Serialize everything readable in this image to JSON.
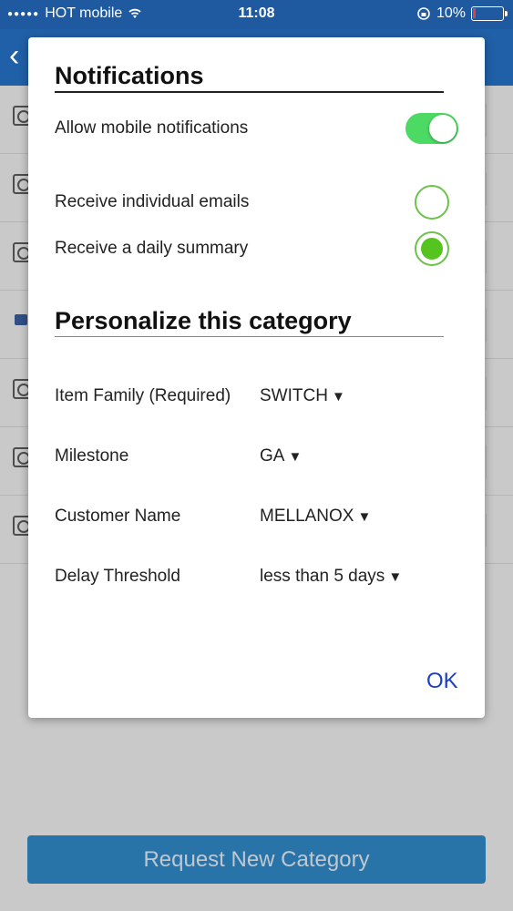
{
  "status_bar": {
    "carrier": "HOT mobile",
    "time": "11:08",
    "battery_percent": "10%",
    "battery_level": 0.1
  },
  "header": {
    "back_icon": "chevron-left-icon"
  },
  "dialog": {
    "notifications_title": "Notifications",
    "allow_mobile_label": "Allow mobile notifications",
    "allow_mobile_on": true,
    "receive_individual_label": "Receive individual emails",
    "receive_individual_selected": false,
    "receive_daily_label": "Receive a daily summary",
    "receive_daily_selected": true,
    "personalize_title": "Personalize this category",
    "fields": [
      {
        "label": "Item Family (Required)",
        "value": "SWITCH"
      },
      {
        "label": "Milestone",
        "value": "GA"
      },
      {
        "label": "Customer Name",
        "value": "MELLANOX"
      },
      {
        "label": "Delay Threshold",
        "value": "less than 5 days"
      }
    ],
    "ok_label": "OK"
  },
  "footer": {
    "request_button_label": "Request New Category"
  },
  "colors": {
    "header_blue": "#2060a8",
    "toggle_green": "#4cd964",
    "radio_green": "#56c41e",
    "ok_blue": "#1e40c0",
    "request_button_bg": "#2874a8"
  }
}
